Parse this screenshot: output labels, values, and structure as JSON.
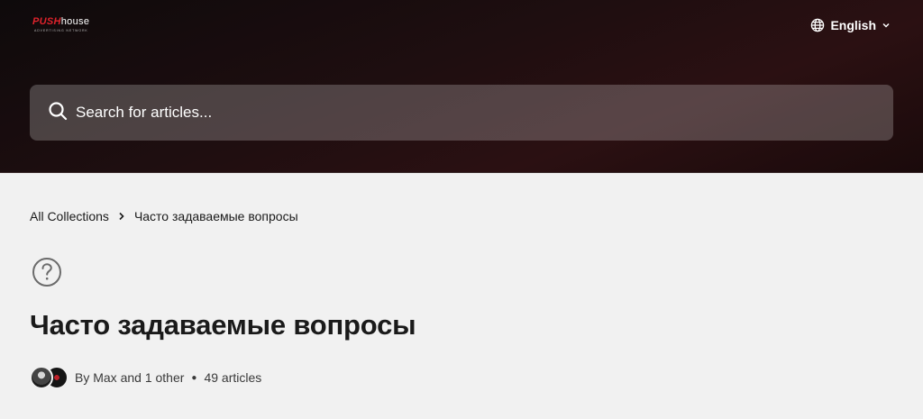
{
  "header": {
    "logo": {
      "primary": "PUSH",
      "secondary": "house",
      "tagline": "ADVERTISING NETWORK"
    },
    "language": {
      "label": "English",
      "icon": "globe-icon",
      "caret_icon": "chevron-down-icon"
    }
  },
  "search": {
    "placeholder": "Search for articles...",
    "value": "",
    "icon": "search-icon"
  },
  "breadcrumb": {
    "items": [
      "All Collections",
      "Часто задаваемые вопросы"
    ]
  },
  "collection": {
    "icon": "question-circle-icon",
    "title": "Часто задаваемые вопросы",
    "authors_text": "By Max and 1 other",
    "article_count": "49 articles"
  },
  "colors": {
    "header_bg": "#1f0e10",
    "brand_red": "#e0232c",
    "page_bg": "#f1f1f1",
    "text_primary": "#1a1a1a"
  }
}
